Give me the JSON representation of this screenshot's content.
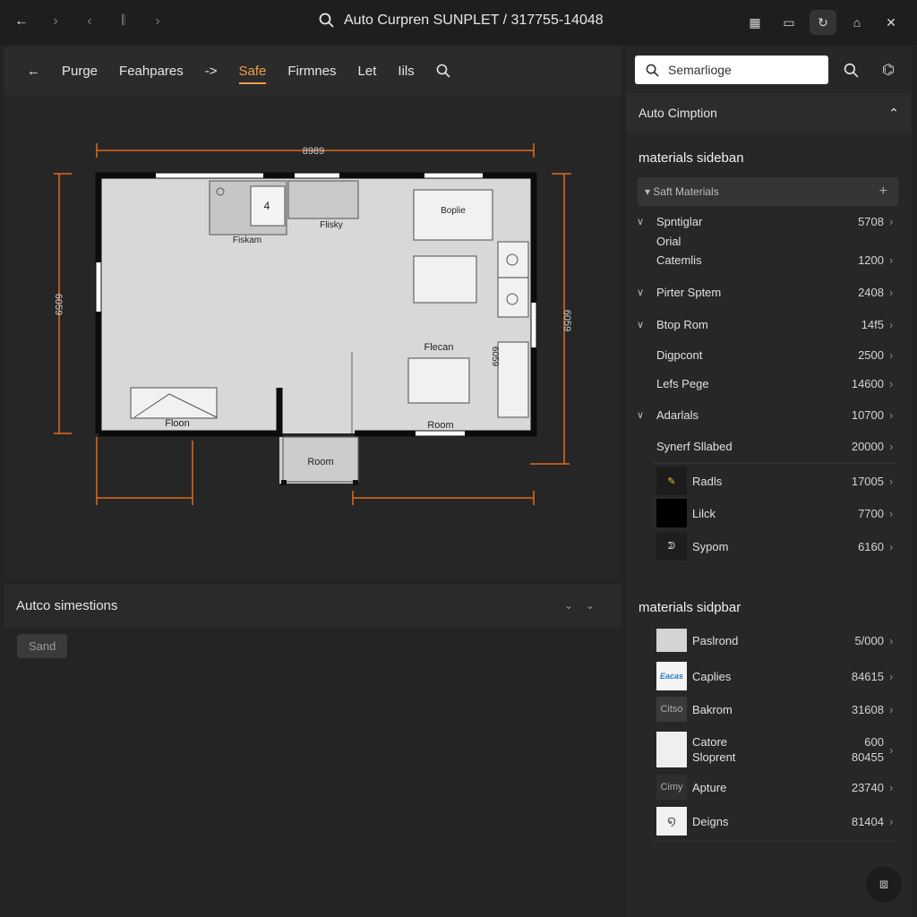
{
  "window": {
    "title": "Auto Curpren SUNPLET / 317755-14048"
  },
  "toolbar": {
    "items": [
      "Purge",
      "Feahpares",
      "Safe",
      "Firmnes",
      "Let",
      "Iils"
    ],
    "arrow": "->",
    "active": "Safe"
  },
  "floorplan": {
    "dim_top": "8989",
    "dim_left": "6059",
    "dim_right": "6059",
    "dim_inner": "6059",
    "labels": {
      "fixture_num": "4",
      "fixture_label": "Fiskam",
      "fixture2_label": "Flisky",
      "bedroom": "Boplie",
      "main_room": "Flecan",
      "floor": "Floon",
      "room_bottom": "Room",
      "room_entry": "Room"
    }
  },
  "bottom_panel": {
    "title": "Autco simestions",
    "chip": "Sand"
  },
  "sidebar": {
    "search_placeholder": "Semarlioge",
    "auto_section": "Auto Cimption",
    "materials_title_1": "materials sideban",
    "filter_label": "Saft Materials",
    "materials_title_2": "materials sidpbar",
    "rows": [
      {
        "label": "Spntiglar",
        "value": "5708",
        "chevron": true
      },
      {
        "label": "Orial",
        "value": "",
        "chevron": false
      },
      {
        "label": "Catemlis",
        "value": "1200",
        "chevron": false
      },
      {
        "label": "Pirter Sptem",
        "value": "2408",
        "chevron": true
      },
      {
        "label": "Btop Rom",
        "value": "14f5",
        "chevron": true
      },
      {
        "label": "Digpcont",
        "value": "2500",
        "chevron": false
      },
      {
        "label": "Lefs Pege",
        "value": "14600",
        "chevron": false
      },
      {
        "label": "Adarlals",
        "value": "10700",
        "chevron": true
      },
      {
        "label": "Synerf Sllabed",
        "value": "20000",
        "chevron": false
      }
    ],
    "swatch_rows_1": [
      {
        "label": "Radls",
        "value": "17005",
        "swatch": "pencil"
      },
      {
        "label": "Lilck",
        "value": "7700",
        "swatch": "black"
      },
      {
        "label": "Sypom",
        "value": "6160",
        "swatch": "icon"
      }
    ],
    "swatch_rows_2": [
      {
        "label": "Paslrond",
        "value": "5/000",
        "swatch": "light"
      },
      {
        "label": "Caplies",
        "value": "84615",
        "swatch": "blue-text",
        "swatch_text": "Eacas"
      },
      {
        "label": "Bakrom",
        "value": "31608",
        "swatch": "text",
        "swatch_text": "Citso"
      },
      {
        "label": "Catore",
        "label2": "Sloprent",
        "value": "600",
        "value2": "80455",
        "swatch": "white"
      },
      {
        "label": "Apture",
        "value": "23740",
        "swatch": "text",
        "swatch_text": "Cimy"
      },
      {
        "label": "Deigns",
        "value": "81404",
        "swatch": "swirl"
      }
    ]
  },
  "colors": {
    "accent": "#f0a04a",
    "dim_line": "#e06a1c",
    "bg": "#232324"
  }
}
